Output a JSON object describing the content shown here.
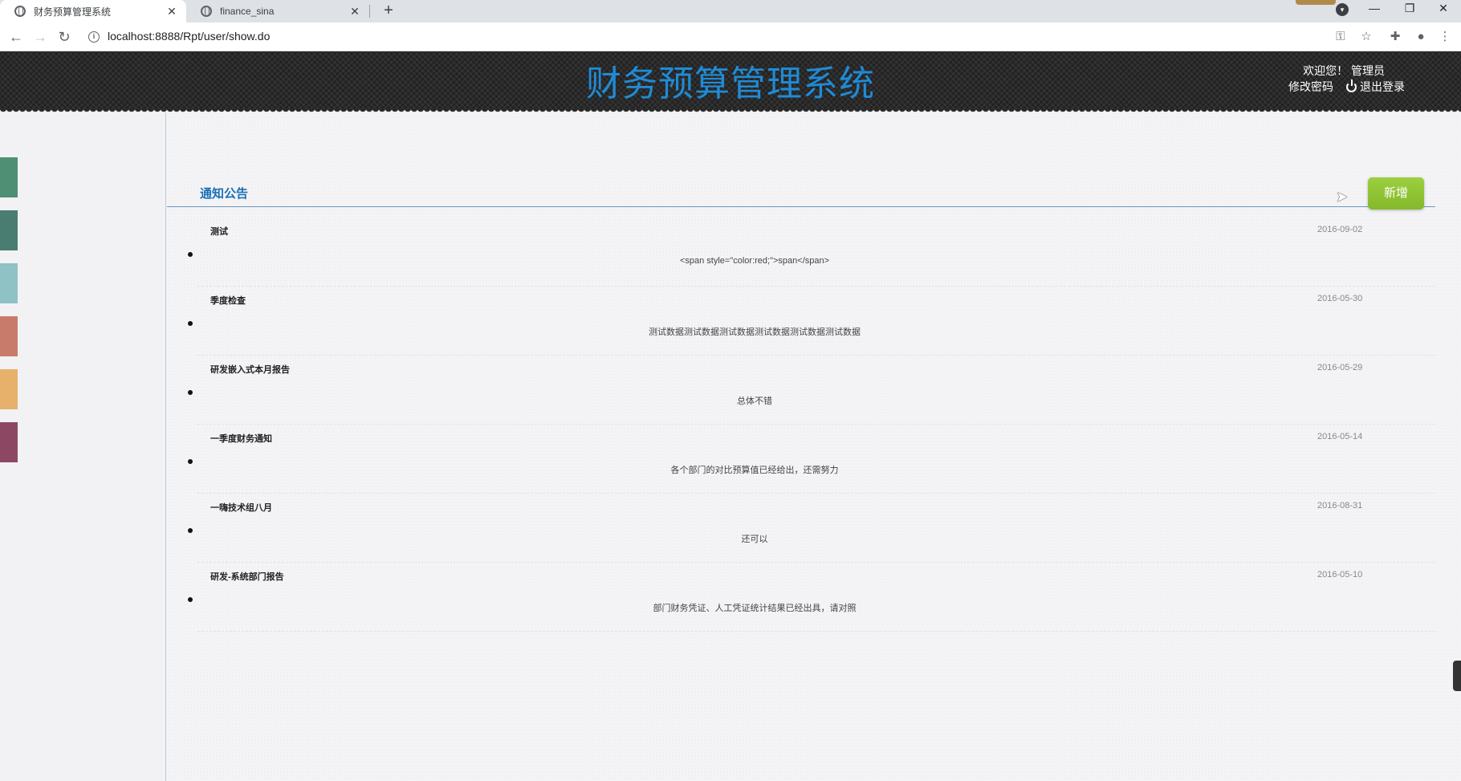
{
  "browser": {
    "tabs": [
      {
        "title": "财务预算管理系统",
        "active": true
      },
      {
        "title": "finance_sina",
        "active": false
      }
    ],
    "url": "localhost:8888/Rpt/user/show.do"
  },
  "header": {
    "title": "财务预算管理系统",
    "welcome": "欢迎您！ 管理员",
    "change_password": "修改密码",
    "logout": "退出登录"
  },
  "sidebar": {
    "swatches": [
      "#4f8f74",
      "#4a7d72",
      "#8fc2c4",
      "#c97b6b",
      "#e7b16b",
      "#8c4863"
    ]
  },
  "main": {
    "section_title": "通知公告",
    "add_button": "新增",
    "notices": [
      {
        "title": "测试",
        "date": "2016-09-02",
        "body": "<span style=\"color:red;\">span</span>"
      },
      {
        "title": "季度检查",
        "date": "2016-05-30",
        "body": "测试数据测试数据测试数据测试数据测试数据测试数据"
      },
      {
        "title": "研发嵌入式本月报告",
        "date": "2016-05-29",
        "body": "总体不错"
      },
      {
        "title": "一季度财务通知",
        "date": "2016-05-14",
        "body": "各个部门的对比预算值已经给出，还需努力"
      },
      {
        "title": "一嗨技术组八月",
        "date": "2016-08-31",
        "body": "还可以"
      },
      {
        "title": "研发-系统部门报告",
        "date": "2016-05-10",
        "body": "部门财务凭证、人工凭证统计结果已经出具，请对照"
      }
    ]
  }
}
